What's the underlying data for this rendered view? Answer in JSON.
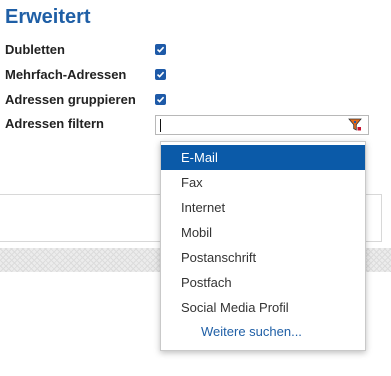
{
  "section_title": "Erweitert",
  "rows": {
    "dubletten": {
      "label": "Dubletten",
      "checked": true
    },
    "mehrfach": {
      "label": "Mehrfach-Adressen",
      "checked": true
    },
    "gruppieren": {
      "label": "Adressen gruppieren",
      "checked": true
    },
    "filtern": {
      "label": "Adressen filtern",
      "value": ""
    }
  },
  "dropdown": {
    "options": [
      "E-Mail",
      "Fax",
      "Internet",
      "Mobil",
      "Postanschrift",
      "Postfach",
      "Social Media Profil"
    ],
    "selected_index": 0,
    "more_link": "Weitere suchen..."
  },
  "colors": {
    "accent": "#1f5fa6",
    "selected_bg": "#0b5aa8",
    "checkbox": "#1e5aa8"
  },
  "icons": {
    "filter": "filter-funnel-icon",
    "check": "check-icon"
  }
}
